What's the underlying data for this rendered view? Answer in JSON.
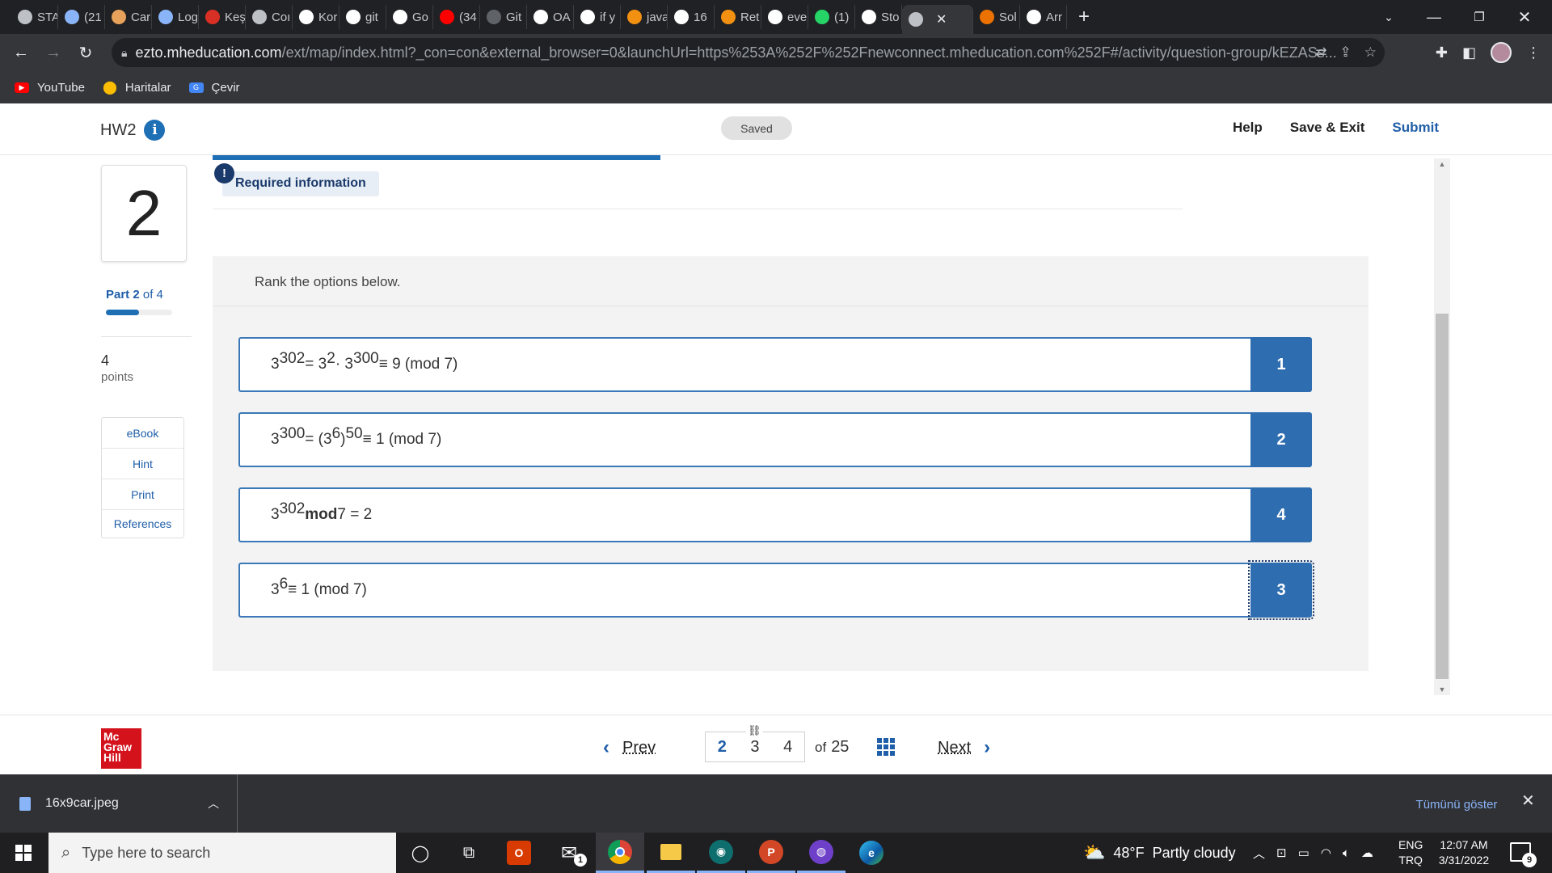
{
  "browser": {
    "tabs": [
      {
        "label": "STA",
        "icon": "globe-icon",
        "color": "#bdc1c6"
      },
      {
        "label": "(21",
        "icon": "chat-icon",
        "color": "#8ab4f8"
      },
      {
        "label": "Car",
        "icon": "grid-logo-icon",
        "color": "#e6a15a"
      },
      {
        "label": "Log",
        "icon": "chart-icon",
        "color": "#8ab4f8"
      },
      {
        "label": "Keş",
        "icon": "k-logo-icon",
        "color": "#d93025"
      },
      {
        "label": "Coı",
        "icon": "globe-icon",
        "color": "#bdc1c6"
      },
      {
        "label": "Kor",
        "icon": "github-icon",
        "color": "#ffffff"
      },
      {
        "label": "git",
        "icon": "google-icon",
        "color": "#ffffff"
      },
      {
        "label": "Go",
        "icon": "google-icon",
        "color": "#ffffff"
      },
      {
        "label": "(34",
        "icon": "youtube-icon",
        "color": "#ff0000"
      },
      {
        "label": "Git",
        "icon": "github-icon",
        "color": "#5f6368"
      },
      {
        "label": "OA",
        "icon": "github-icon",
        "color": "#ffffff"
      },
      {
        "label": "if y",
        "icon": "google-icon",
        "color": "#ffffff"
      },
      {
        "label": "java",
        "icon": "java-icon",
        "color": "#f29111"
      },
      {
        "label": "16",
        "icon": "google-icon",
        "color": "#ffffff"
      },
      {
        "label": "Ret",
        "icon": "java-icon",
        "color": "#f29111"
      },
      {
        "label": "eve",
        "icon": "google-icon",
        "color": "#ffffff"
      },
      {
        "label": "(1)",
        "icon": "whatsapp-icon",
        "color": "#25d366"
      },
      {
        "label": "Sto",
        "icon": "github-icon",
        "color": "#ffffff"
      },
      {
        "label": "",
        "icon": "globe-icon",
        "color": "#bdc1c6",
        "active": true
      },
      {
        "label": "Sol",
        "icon": "chegg-icon",
        "color": "#eb7100"
      },
      {
        "label": "Arr",
        "icon": "google-icon",
        "color": "#ffffff"
      }
    ],
    "url_host": "ezto.mheducation.com",
    "url_path": "/ext/map/index.html?_con=con&external_browser=0&launchUrl=https%253A%252F%252Fnewconnect.mheducation.com%252F#/activity/question-group/kEZASs...",
    "bookmarks": [
      "YouTube",
      "Haritalar",
      "Çevir"
    ]
  },
  "header": {
    "title": "HW2",
    "status": "Saved",
    "help": "Help",
    "save_exit": "Save & Exit",
    "submit": "Submit"
  },
  "sidebar": {
    "question_number": "2",
    "part_prefix": "Part",
    "part_current": "2",
    "part_of": "of 4",
    "part_progress": 0.5,
    "points_value": "4",
    "points_label": "points",
    "tools": [
      "eBook",
      "Hint",
      "Print",
      "References"
    ]
  },
  "main": {
    "required_label": "Required information",
    "instruction": "Rank the options below.",
    "rank_items": [
      {
        "html": "3<sup>302</sup> = 3<sup>2</sup> · 3<sup>300</sup> ≡ 9 (mod 7)",
        "rank": "1"
      },
      {
        "html": "3<sup>300</sup> = (3<sup>6</sup>)<sup>50</sup> ≡ 1 (mod 7)",
        "rank": "2"
      },
      {
        "html": "3<sup>302</sup> <b>mod</b> 7 = 2",
        "rank": "4"
      },
      {
        "html": "3<sup>6</sup> ≡ 1 (mod 7)",
        "rank": "3",
        "focused": true
      }
    ]
  },
  "footer": {
    "logo_text": [
      "Mc",
      "Graw",
      "Hill"
    ],
    "prev": "Prev",
    "next": "Next",
    "pages": [
      "2",
      "3",
      "4"
    ],
    "current_page": "2",
    "of_label": "of",
    "total": "25"
  },
  "downloads": {
    "file": "16x9car.jpeg",
    "show_all": "Tümünü göster"
  },
  "taskbar": {
    "search_placeholder": "Type here to search",
    "weather": "48°F  Partly cloudy",
    "lang_top": "ENG",
    "lang_bottom": "TRQ",
    "time": "12:07 AM",
    "date": "3/31/2022",
    "notifications": "9",
    "mail_badge": "1"
  },
  "colors": {
    "brand_blue": "#1f5ea8",
    "rank_blue": "#2e6db0",
    "mcgraw_red": "#d4121c"
  }
}
